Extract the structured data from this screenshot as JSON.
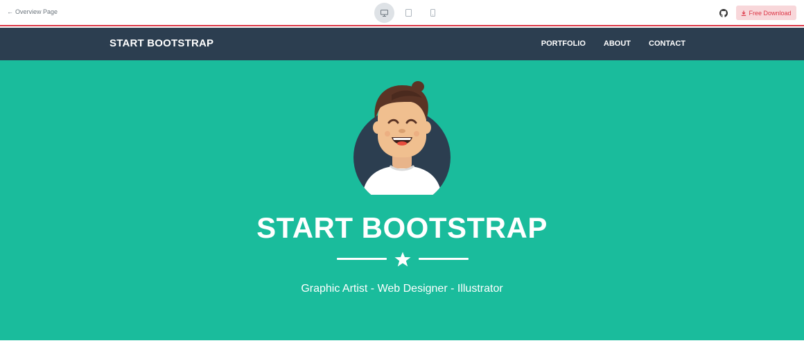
{
  "preview_bar": {
    "back_label": "Overview Page",
    "devices": [
      "desktop-icon",
      "tablet-icon",
      "mobile-icon"
    ],
    "active_device": "desktop",
    "download_label": "Free Download",
    "accent_color": "#dc3545"
  },
  "nav": {
    "brand": "START BOOTSTRAP",
    "links": [
      "PORTFOLIO",
      "ABOUT",
      "CONTACT"
    ],
    "background": "#2c3e50"
  },
  "masthead": {
    "title": "START BOOTSTRAP",
    "subtitle": "Graphic Artist - Web Designer - Illustrator",
    "background": "#1abc9c",
    "divider_icon": "star-icon",
    "avatar_icon": "avatar-illustration"
  }
}
